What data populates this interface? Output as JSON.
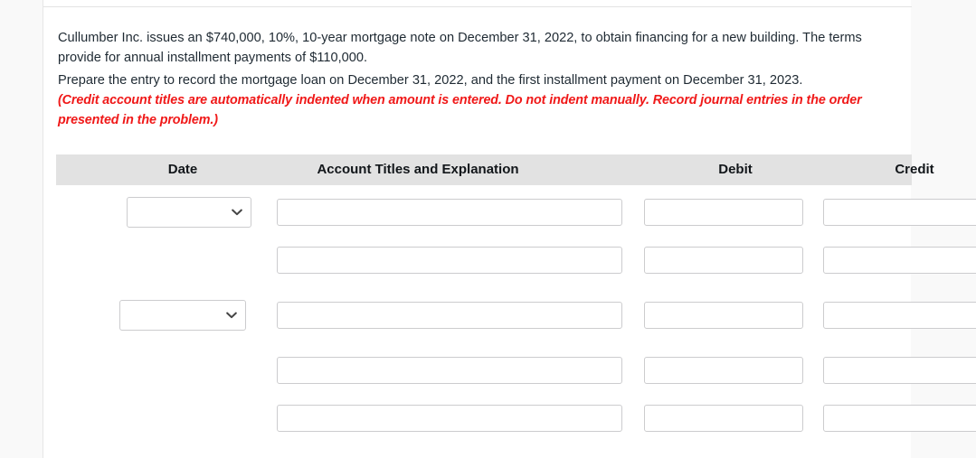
{
  "prompt": {
    "intro": "Cullumber Inc. issues an $740,000, 10%, 10-year mortgage note on December 31, 2022, to obtain financing for a new building. The terms provide for annual installment payments of $110,000.",
    "task": "Prepare the entry to record the mortgage loan on December 31, 2022, and the first installment payment on December 31, 2023.",
    "note": "(Credit account titles are automatically indented when amount is entered. Do not indent manually. Record journal entries in the order presented in the problem.)"
  },
  "table": {
    "headers": {
      "date": "Date",
      "account": "Account Titles and Explanation",
      "debit": "Debit",
      "credit": "Credit"
    },
    "header_bg": "#e2e2e2",
    "rows": [
      {
        "has_date_select": true,
        "date_value": "",
        "date_placeholder": "",
        "account_value": "",
        "account_placeholder": "",
        "debit_value": "",
        "debit_placeholder": "",
        "credit_value": "",
        "credit_placeholder": ""
      },
      {
        "has_date_select": false,
        "date_value": "",
        "date_placeholder": "",
        "account_value": "",
        "account_placeholder": "",
        "debit_value": "",
        "debit_placeholder": "",
        "credit_value": "",
        "credit_placeholder": ""
      },
      {
        "has_date_select": true,
        "date_value": "",
        "date_placeholder": "",
        "account_value": "",
        "account_placeholder": "",
        "debit_value": "",
        "debit_placeholder": "",
        "credit_value": "",
        "credit_placeholder": ""
      },
      {
        "has_date_select": false,
        "date_value": "",
        "date_placeholder": "",
        "account_value": "",
        "account_placeholder": "",
        "debit_value": "",
        "debit_placeholder": "",
        "credit_value": "",
        "credit_placeholder": ""
      },
      {
        "has_date_select": false,
        "date_value": "",
        "date_placeholder": "",
        "account_value": "",
        "account_placeholder": "",
        "debit_value": "",
        "debit_placeholder": "",
        "credit_value": "",
        "credit_placeholder": ""
      }
    ]
  },
  "icons": {
    "chevron_down": "chevron-down-icon"
  },
  "colors": {
    "note_red": "#f01818",
    "page_bg": "#f9f9f9",
    "content_bg": "#ffffff",
    "field_border": "#ccccce"
  }
}
